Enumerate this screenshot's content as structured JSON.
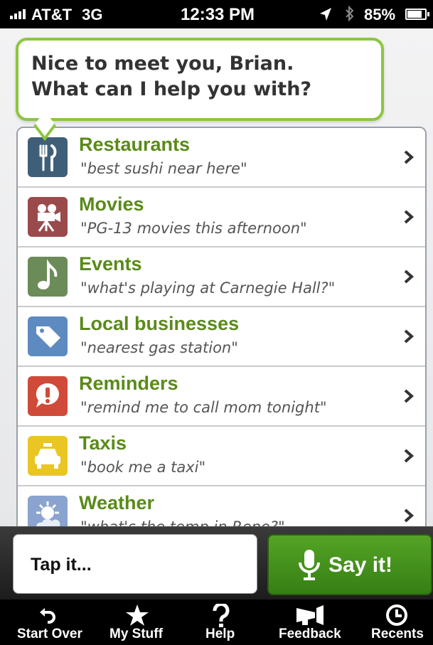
{
  "status_bar": {
    "carrier": "AT&T",
    "network": "3G",
    "time": "12:33 PM",
    "battery": "85%",
    "battery_level": 0.85
  },
  "bubble": {
    "line1": "Nice to meet you, Brian.",
    "line2": "What can I help you with?"
  },
  "categories": [
    {
      "title": "Restaurants",
      "example": "\"best sushi near here\"",
      "icon": "fork-knife-icon",
      "color": "#3f5f79"
    },
    {
      "title": "Movies",
      "example": "\"PG-13 movies this afternoon\"",
      "icon": "film-camera-icon",
      "color": "#9b4a4c"
    },
    {
      "title": "Events",
      "example": "\"what's playing at Carnegie Hall?\"",
      "icon": "music-note-icon",
      "color": "#6b8b58"
    },
    {
      "title": "Local businesses",
      "example": "\"nearest gas station\"",
      "icon": "tag-icon",
      "color": "#5d8ac0"
    },
    {
      "title": "Reminders",
      "example": "\"remind me to call mom tonight\"",
      "icon": "alert-bubble-icon",
      "color": "#cf4a38"
    },
    {
      "title": "Taxis",
      "example": "\"book me a taxi\"",
      "icon": "taxi-icon",
      "color": "#e9c623"
    },
    {
      "title": "Weather",
      "example": "\"what's the temp in Reno?\"",
      "icon": "weather-icon",
      "color": "#8aa3cf"
    }
  ],
  "input": {
    "tap_label": "Tap it...",
    "say_label": "Say it!"
  },
  "tabs": [
    {
      "label": "Start Over",
      "icon": "undo-arrow-icon"
    },
    {
      "label": "My Stuff",
      "icon": "star-icon"
    },
    {
      "label": "Help",
      "icon": "question-icon"
    },
    {
      "label": "Feedback",
      "icon": "megaphone-icon"
    },
    {
      "label": "Recents",
      "icon": "clock-icon"
    }
  ],
  "colors": {
    "accent_green": "#5a8a1a",
    "bubble_border": "#8cc63f",
    "say_button": "#4a9620"
  }
}
